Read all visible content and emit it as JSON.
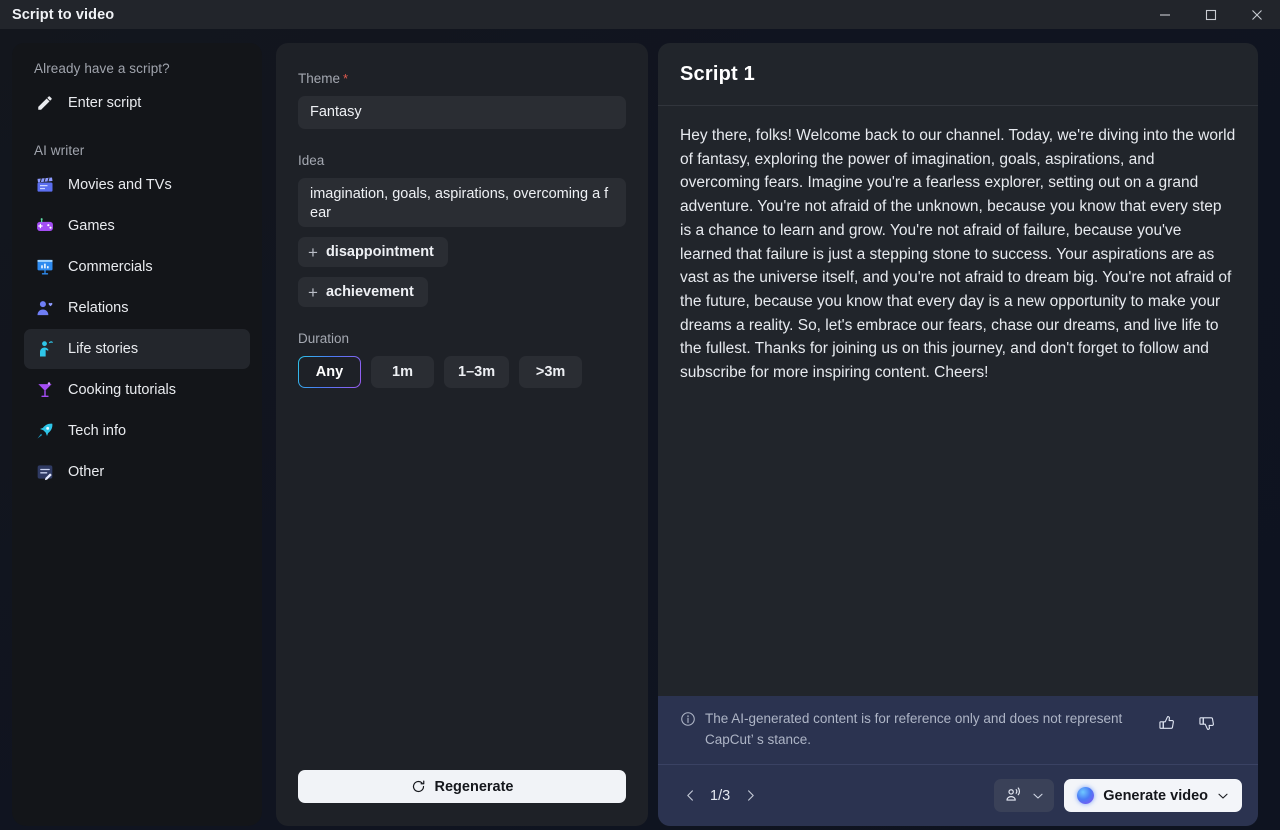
{
  "window": {
    "title": "Script to video",
    "controls": [
      {
        "name": "minimize-button",
        "icon": "minimize-icon"
      },
      {
        "name": "maximize-button",
        "icon": "maximize-icon"
      },
      {
        "name": "close-button",
        "icon": "close-icon"
      }
    ]
  },
  "sidebar": {
    "section_script_heading": "Already have a script?",
    "enter_script_label": "Enter script",
    "section_ai_heading": "AI writer",
    "items": [
      {
        "label": "Movies and TVs",
        "icon": "clapperboard-icon"
      },
      {
        "label": "Games",
        "icon": "gamepad-icon"
      },
      {
        "label": "Commercials",
        "icon": "presentation-chart-icon"
      },
      {
        "label": "Relations",
        "icon": "person-heart-icon"
      },
      {
        "label": "Life stories",
        "icon": "person-waving-icon"
      },
      {
        "label": "Cooking tutorials",
        "icon": "cocktail-glass-icon"
      },
      {
        "label": "Tech info",
        "icon": "rocket-icon"
      },
      {
        "label": "Other",
        "icon": "document-edit-icon"
      }
    ],
    "active_item": "Life stories"
  },
  "form": {
    "theme_label": "Theme",
    "theme_required_mark": "*",
    "theme_value": "Fantasy",
    "idea_label": "Idea",
    "idea_value": "imagination, goals, aspirations, overcoming a fear",
    "suggestion_chips": [
      {
        "plus": "+",
        "label": "disappointment"
      },
      {
        "plus": "+",
        "label": "achievement"
      }
    ],
    "duration_label": "Duration",
    "duration_options": [
      "Any",
      "1m",
      "1–3m",
      ">3m"
    ],
    "duration_selected": "Any",
    "regenerate_label": "Regenerate",
    "regenerate_icon": "refresh-icon"
  },
  "script_panel": {
    "title": "Script 1",
    "text": "Hey there, folks! Welcome back to our channel. Today, we're diving into the world of fantasy, exploring the power of imagination, goals, aspirations, and overcoming fears.\nImagine you're a fearless explorer, setting out on a grand adventure. You're not afraid of the unknown, because you know that every step is a chance to learn and grow. You're not afraid of failure, because you've learned that failure is just a stepping stone to success.\nYour aspirations are as vast as the universe itself, and you're not afraid to dream big. You're not afraid of the future, because you know that every day is a new opportunity to make your dreams a reality.\nSo, let's embrace our fears, chase our dreams, and live life to the fullest. Thanks for joining us on this journey, and don't forget to follow and subscribe for more inspiring content. Cheers!",
    "disclaimer": "The AI-generated content is for reference only and does not represent CapCut’ s stance.",
    "disclaimer_icon": "info-icon",
    "thumbs_up_icon": "thumbs-up-icon",
    "thumbs_down_icon": "thumbs-down-icon",
    "pager": {
      "prev_icon": "chevron-left-icon",
      "next_icon": "chevron-right-icon",
      "label": "1/3"
    },
    "voice_selector": {
      "icon": "voice-speaker-icon",
      "chevron": "chevron-down-icon"
    },
    "generate_button": {
      "icon": "ai-orb-icon",
      "label": "Generate video",
      "chevron": "chevron-down-icon"
    }
  },
  "colors": {
    "titlebar": "#22252b",
    "sidebar_bg": "#131519",
    "form_bg": "#1e2127",
    "script_bg": "#21252b",
    "script_footer_bg": "#2b3350",
    "accent_gradient_start": "#2ec5e8",
    "accent_gradient_end": "#9b5bf0",
    "required_mark": "#e05a4e",
    "button_light": "#f1f3f7"
  }
}
